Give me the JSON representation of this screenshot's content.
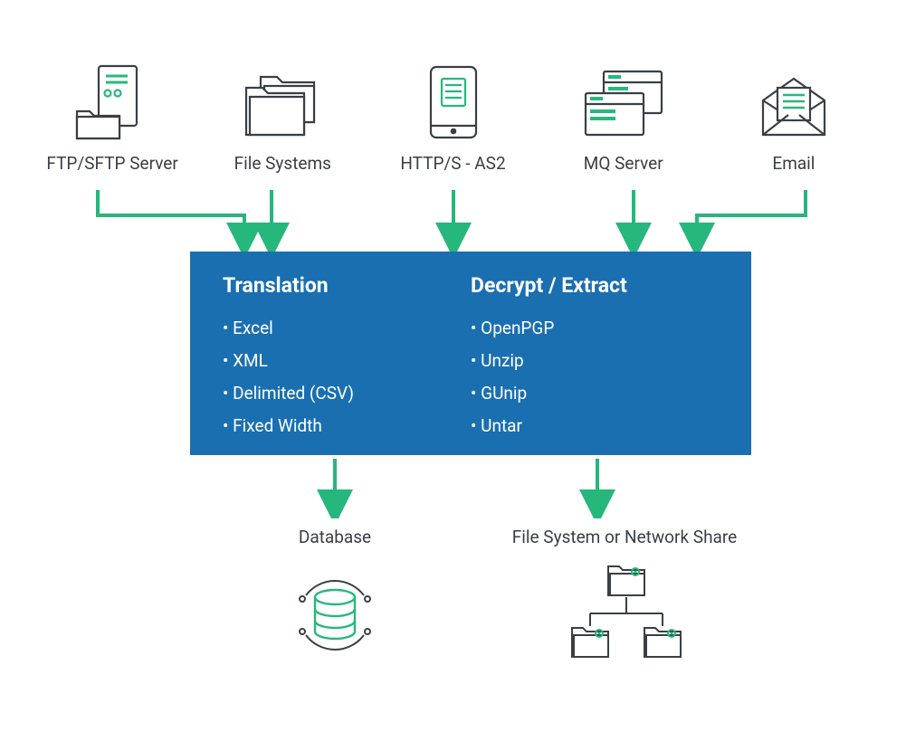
{
  "sources": [
    {
      "label": "FTP/SFTP Server"
    },
    {
      "label": "File Systems"
    },
    {
      "label": "HTTP/S - AS2"
    },
    {
      "label": "MQ Server"
    },
    {
      "label": "Email"
    }
  ],
  "center": {
    "left_title": "Translation",
    "left_items": [
      "Excel",
      "XML",
      "Delimited (CSV)",
      "Fixed Width"
    ],
    "right_title": "Decrypt / Extract",
    "right_items": [
      "OpenPGP",
      "Unzip",
      "GUnip",
      "Untar"
    ]
  },
  "outputs": {
    "left_label": "Database",
    "right_label": "File System or Network Share"
  },
  "colors": {
    "box": "#1a6fb1",
    "arrow": "#25b77b",
    "stroke": "#3a3f46",
    "accent": "#27b87c"
  }
}
